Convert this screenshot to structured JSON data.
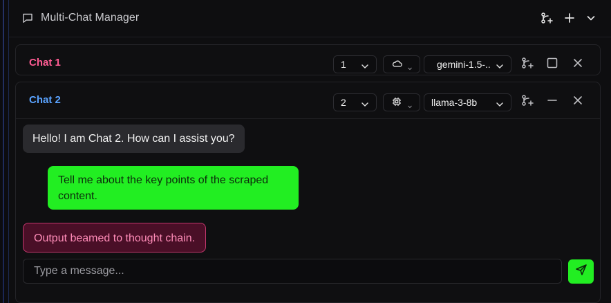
{
  "header": {
    "title": "Multi-Chat Manager",
    "icons": [
      "message-square-icon",
      "branch-plus-icon",
      "plus-icon",
      "chevron-down-icon"
    ]
  },
  "chats": [
    {
      "name": "Chat 1",
      "name_color": "#ff5c93",
      "number": "1",
      "provider_icon": "cloud-icon",
      "model": "gemini-1.5-..",
      "state": "collapsed"
    },
    {
      "name": "Chat 2",
      "name_color": "#5aa3ff",
      "number": "2",
      "provider_icon": "chip-icon",
      "model": "llama-3-8b",
      "state": "expanded",
      "messages": [
        {
          "role": "assistant",
          "text": "Hello! I am Chat 2. How can I assist you?"
        },
        {
          "role": "user",
          "text": "Tell me about the key points of the scraped content."
        },
        {
          "role": "system",
          "text": "Output beamed to thought chain."
        }
      ],
      "input": {
        "value": "",
        "placeholder": "Type a message..."
      }
    }
  ],
  "colors": {
    "accent_green": "#22ee22",
    "system_bg": "#4a0f27",
    "system_border": "#c4386e",
    "system_text": "#ff8cb8"
  }
}
